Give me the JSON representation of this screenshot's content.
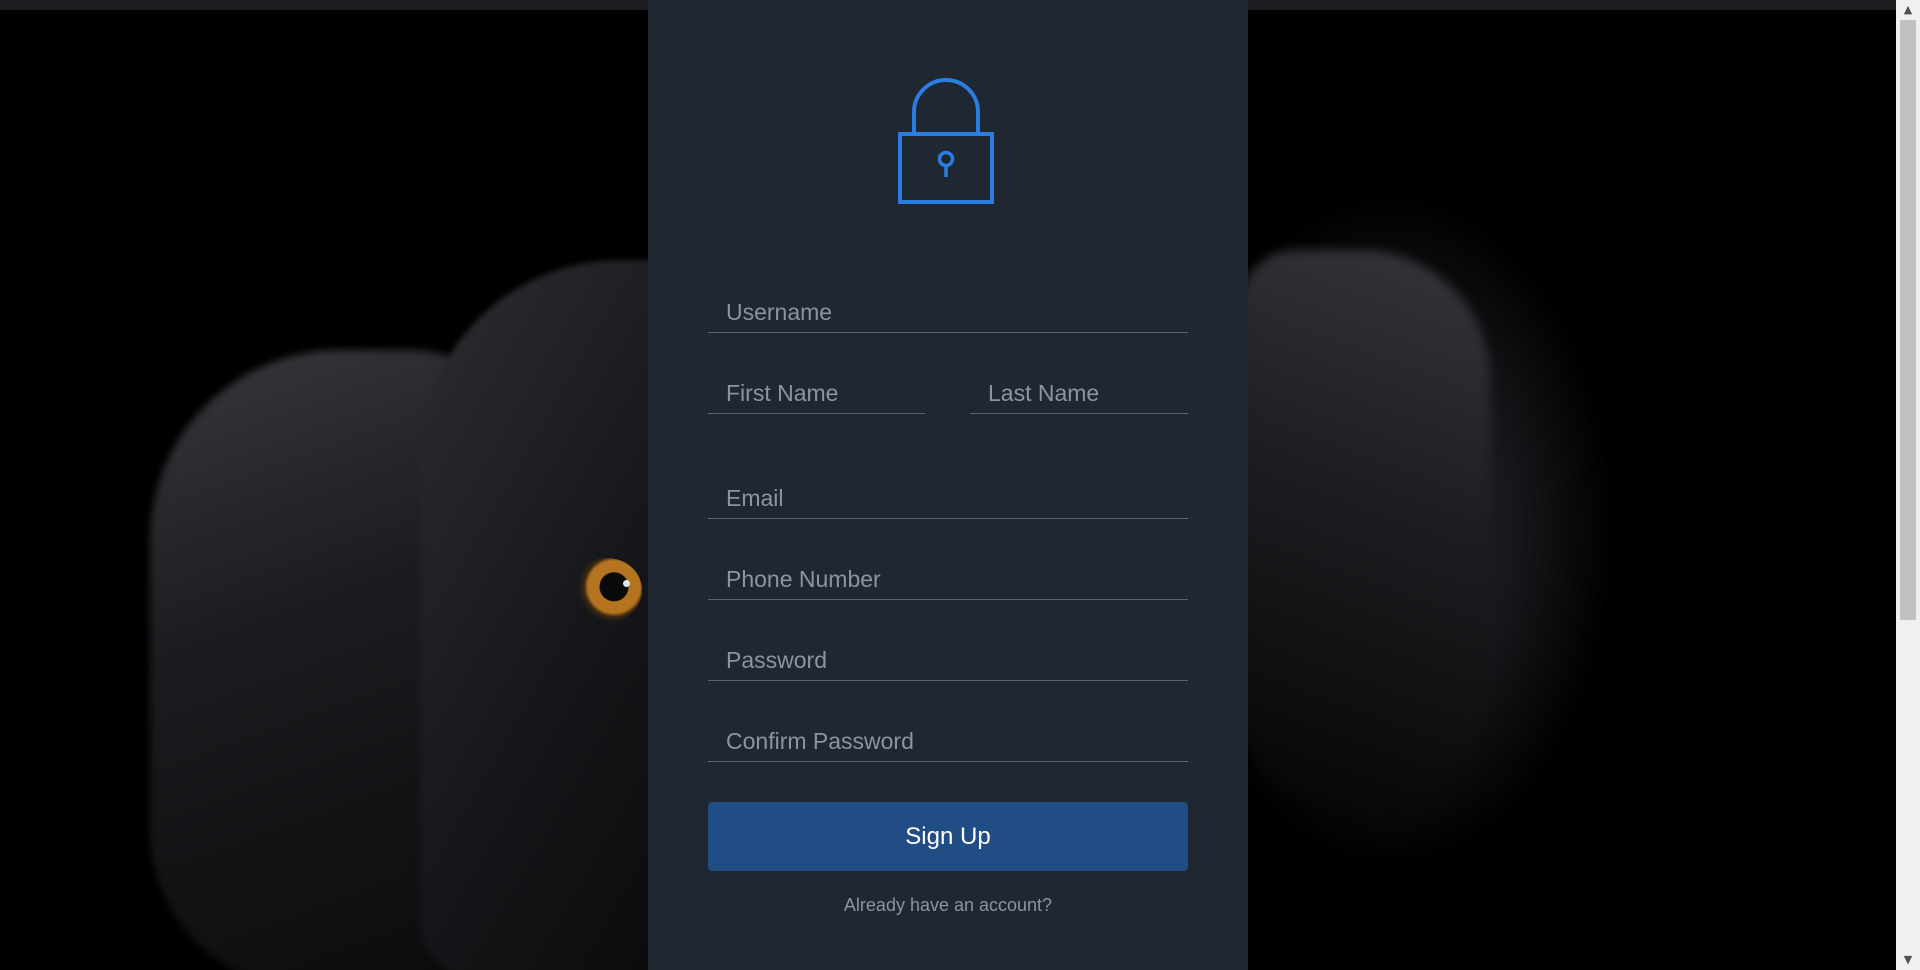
{
  "form": {
    "username_placeholder": "Username",
    "first_name_placeholder": "First Name",
    "last_name_placeholder": "Last Name",
    "email_placeholder": "Email",
    "phone_placeholder": "Phone Number",
    "password_placeholder": "Password",
    "confirm_password_placeholder": "Confirm Password",
    "submit_label": "Sign Up",
    "login_link": "Already have an account?"
  },
  "icons": {
    "header": "lock-icon",
    "scroll_up": "triangle-up-icon",
    "scroll_down": "triangle-down-icon"
  },
  "colors": {
    "panel_background": "#1f2733",
    "accent": "#2a7de1",
    "button": "#214d85",
    "placeholder_text": "#8b95a1",
    "field_underline": "#5a6472"
  }
}
